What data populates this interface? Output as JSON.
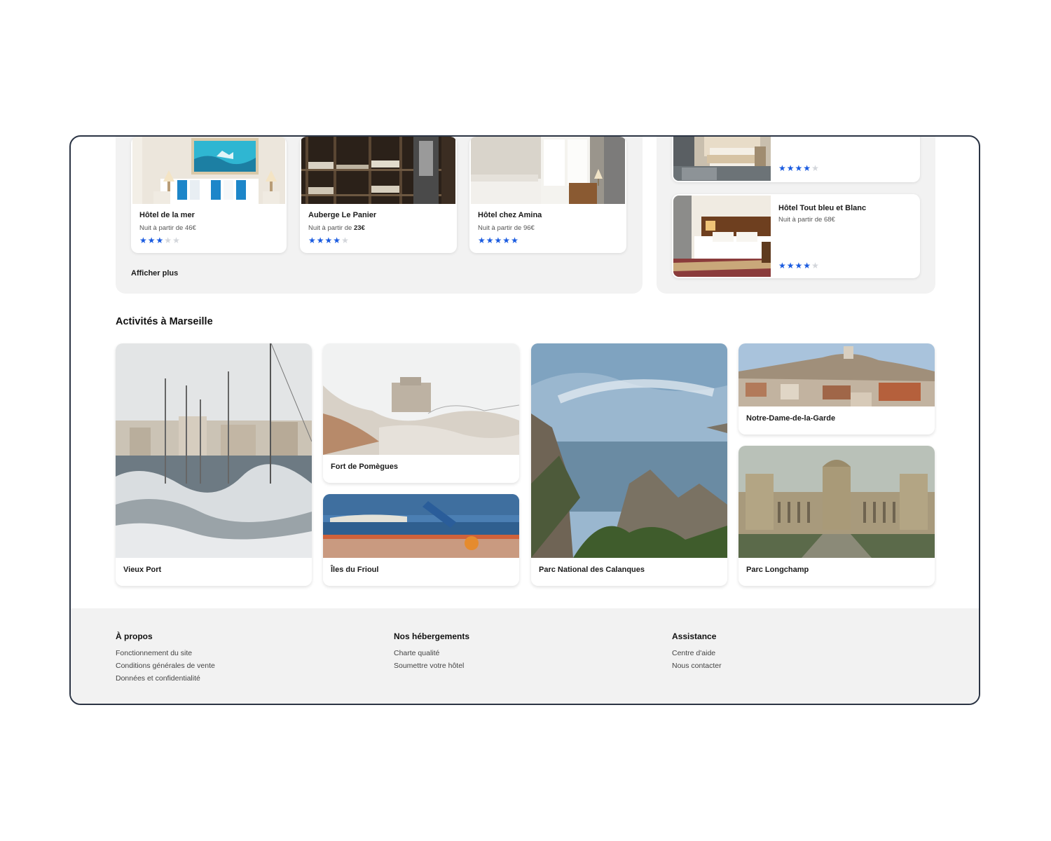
{
  "hotels": {
    "grid": [
      {
        "name": "Hôtel de la mer",
        "price_prefix": "Nuit à partir de",
        "price": "46€",
        "rating": 3,
        "max_rating": 5
      },
      {
        "name": "Auberge Le Panier",
        "price_prefix": "Nuit à partir de",
        "price": "23€",
        "rating": 4,
        "max_rating": 5
      },
      {
        "name": "Hôtel chez Amina",
        "price_prefix": "Nuit à partir de",
        "price": "96€",
        "rating": 5,
        "max_rating": 5
      }
    ],
    "show_more_label": "Afficher plus",
    "side": [
      {
        "name": "",
        "price_prefix": "",
        "price": "",
        "rating": 4,
        "max_rating": 5
      },
      {
        "name": "Hôtel Tout bleu et Blanc",
        "price_prefix": "Nuit à partir de",
        "price": "68€",
        "rating": 4,
        "max_rating": 5
      }
    ]
  },
  "activities": {
    "title": "Activités à Marseille",
    "items": [
      "Vieux Port",
      "Fort de Pomègues",
      "Îles du Frioul",
      "Parc National des Calanques",
      "Notre-Dame-de-la-Garde",
      "Parc Longchamp"
    ]
  },
  "footer": {
    "columns": [
      {
        "title": "À propos",
        "links": [
          "Fonctionnement du site",
          "Conditions générales de vente",
          "Données et confidentialité"
        ]
      },
      {
        "title": "Nos hébergements",
        "links": [
          "Charte qualité",
          "Soumettre votre hôtel"
        ]
      },
      {
        "title": "Assistance",
        "links": [
          "Centre d'aide",
          "Nous contacter"
        ]
      }
    ]
  },
  "colors": {
    "accent": "#1a5be0",
    "star_off": "#d3d6db",
    "panel": "#f2f2f2",
    "frame_border": "#2b3444"
  }
}
